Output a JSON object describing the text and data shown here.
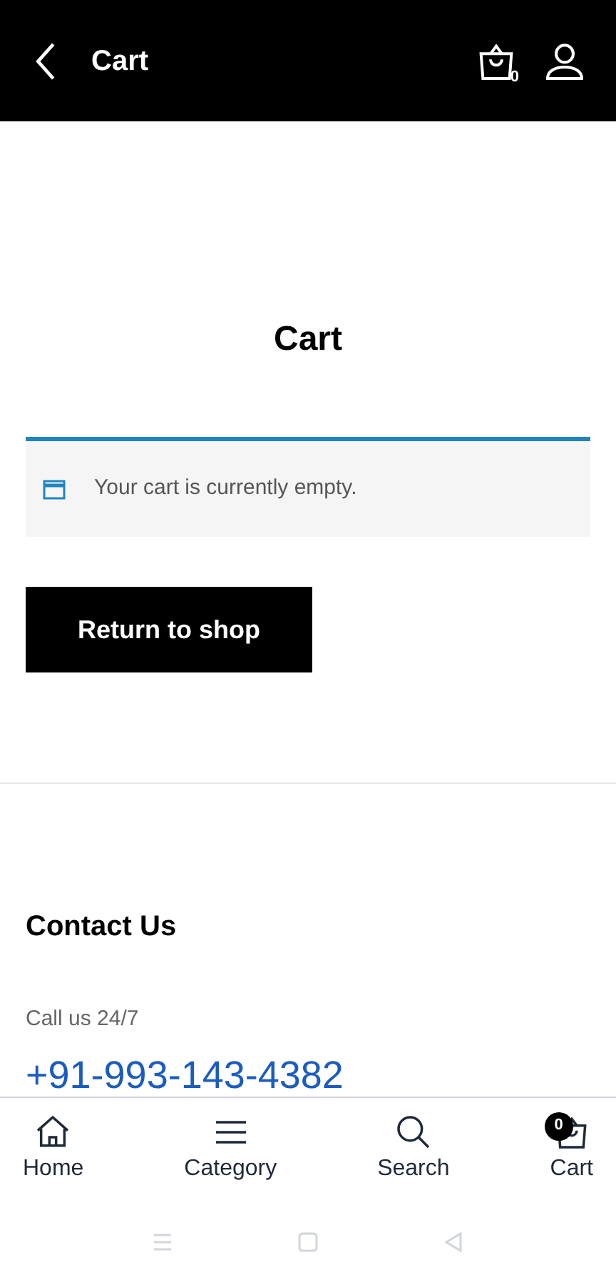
{
  "header": {
    "title": "Cart",
    "cart_count": "0"
  },
  "page_title": "Cart",
  "notice": "Your cart is currently empty.",
  "return_button": "Return to shop",
  "contact": {
    "heading": "Contact Us",
    "call_label": "Call us 24/7",
    "phone": "+91-993-143-4382"
  },
  "bottom_nav": [
    {
      "kind": "home",
      "label": "Home"
    },
    {
      "kind": "category",
      "label": "Category"
    },
    {
      "kind": "search",
      "label": "Search"
    },
    {
      "kind": "cart",
      "label": "Cart",
      "badge": "0"
    }
  ]
}
